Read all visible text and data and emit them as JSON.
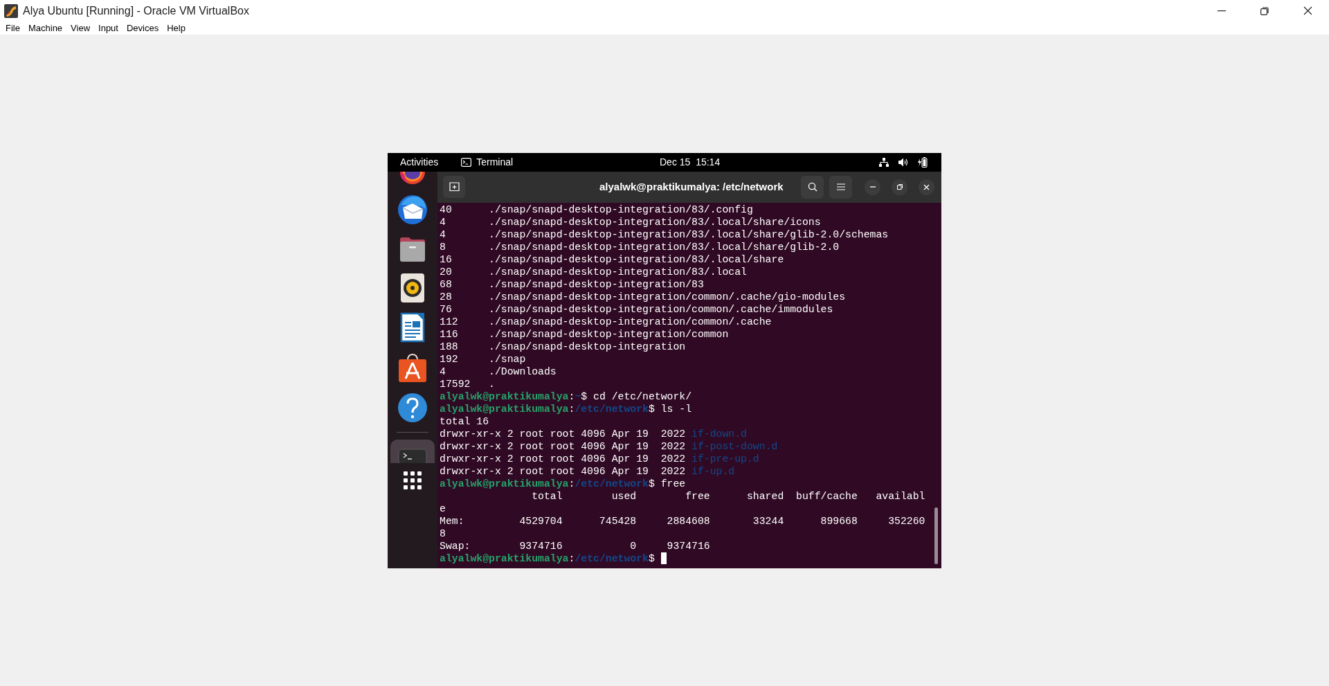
{
  "host_window": {
    "title": "Alya Ubuntu [Running] - Oracle VM VirtualBox",
    "menu": [
      "File",
      "Machine",
      "View",
      "Input",
      "Devices",
      "Help"
    ]
  },
  "top_panel": {
    "activities": "Activities",
    "app_name": "Terminal",
    "clock": "Dec 15  15:14"
  },
  "dock": {
    "items": [
      {
        "kind": "firefox",
        "active": false
      },
      {
        "kind": "thunderbird",
        "active": false
      },
      {
        "kind": "files",
        "active": false
      },
      {
        "kind": "rhythmbox",
        "active": false
      },
      {
        "kind": "writer",
        "active": false
      },
      {
        "kind": "store",
        "active": false
      },
      {
        "kind": "help",
        "active": false
      },
      {
        "kind": "terminal",
        "active": true
      },
      {
        "kind": "apps",
        "active": false
      }
    ]
  },
  "terminal": {
    "title": "alyalwk@praktikumalya: /etc/network",
    "cursor": true,
    "lines": [
      [
        {
          "kind": "plain",
          "text": "40      ./snap/snapd-desktop-integration/83/.config"
        }
      ],
      [
        {
          "kind": "plain",
          "text": "4       ./snap/snapd-desktop-integration/83/.local/share/icons"
        }
      ],
      [
        {
          "kind": "plain",
          "text": "4       ./snap/snapd-desktop-integration/83/.local/share/glib-2.0/schemas"
        }
      ],
      [
        {
          "kind": "plain",
          "text": "8       ./snap/snapd-desktop-integration/83/.local/share/glib-2.0"
        }
      ],
      [
        {
          "kind": "plain",
          "text": "16      ./snap/snapd-desktop-integration/83/.local/share"
        }
      ],
      [
        {
          "kind": "plain",
          "text": "20      ./snap/snapd-desktop-integration/83/.local"
        }
      ],
      [
        {
          "kind": "plain",
          "text": "68      ./snap/snapd-desktop-integration/83"
        }
      ],
      [
        {
          "kind": "plain",
          "text": "28      ./snap/snapd-desktop-integration/common/.cache/gio-modules"
        }
      ],
      [
        {
          "kind": "plain",
          "text": "76      ./snap/snapd-desktop-integration/common/.cache/immodules"
        }
      ],
      [
        {
          "kind": "plain",
          "text": "112     ./snap/snapd-desktop-integration/common/.cache"
        }
      ],
      [
        {
          "kind": "plain",
          "text": "116     ./snap/snapd-desktop-integration/common"
        }
      ],
      [
        {
          "kind": "plain",
          "text": "188     ./snap/snapd-desktop-integration"
        }
      ],
      [
        {
          "kind": "plain",
          "text": "192     ./snap"
        }
      ],
      [
        {
          "kind": "plain",
          "text": "4       ./Downloads"
        }
      ],
      [
        {
          "kind": "plain",
          "text": "17592   ."
        }
      ],
      [
        {
          "kind": "user",
          "text": "alyalwk@praktikumalya"
        },
        {
          "kind": "plain",
          "text": ":"
        },
        {
          "kind": "path",
          "text": "~"
        },
        {
          "kind": "plain",
          "text": "$ cd /etc/network/"
        }
      ],
      [
        {
          "kind": "user",
          "text": "alyalwk@praktikumalya"
        },
        {
          "kind": "plain",
          "text": ":"
        },
        {
          "kind": "path",
          "text": "/etc/network"
        },
        {
          "kind": "plain",
          "text": "$ ls -l"
        }
      ],
      [
        {
          "kind": "plain",
          "text": "total 16"
        }
      ],
      [
        {
          "kind": "plain",
          "text": "drwxr-xr-x 2 root root 4096 Apr 19  2022 "
        },
        {
          "kind": "dir",
          "text": "if-down.d"
        }
      ],
      [
        {
          "kind": "plain",
          "text": "drwxr-xr-x 2 root root 4096 Apr 19  2022 "
        },
        {
          "kind": "dir",
          "text": "if-post-down.d"
        }
      ],
      [
        {
          "kind": "plain",
          "text": "drwxr-xr-x 2 root root 4096 Apr 19  2022 "
        },
        {
          "kind": "dir",
          "text": "if-pre-up.d"
        }
      ],
      [
        {
          "kind": "plain",
          "text": "drwxr-xr-x 2 root root 4096 Apr 19  2022 "
        },
        {
          "kind": "dir",
          "text": "if-up.d"
        }
      ],
      [
        {
          "kind": "user",
          "text": "alyalwk@praktikumalya"
        },
        {
          "kind": "plain",
          "text": ":"
        },
        {
          "kind": "path",
          "text": "/etc/network"
        },
        {
          "kind": "plain",
          "text": "$ free"
        }
      ],
      [
        {
          "kind": "plain",
          "text": "               total        used        free      shared  buff/cache   availabl"
        }
      ],
      [
        {
          "kind": "plain",
          "text": "e"
        }
      ],
      [
        {
          "kind": "plain",
          "text": "Mem:         4529704      745428     2884608       33244      899668     352260"
        }
      ],
      [
        {
          "kind": "plain",
          "text": "8"
        }
      ],
      [
        {
          "kind": "plain",
          "text": "Swap:        9374716           0     9374716"
        }
      ],
      [
        {
          "kind": "user",
          "text": "alyalwk@praktikumalya"
        },
        {
          "kind": "plain",
          "text": ":"
        },
        {
          "kind": "path",
          "text": "/etc/network"
        },
        {
          "kind": "plain",
          "text": "$ "
        }
      ]
    ]
  }
}
